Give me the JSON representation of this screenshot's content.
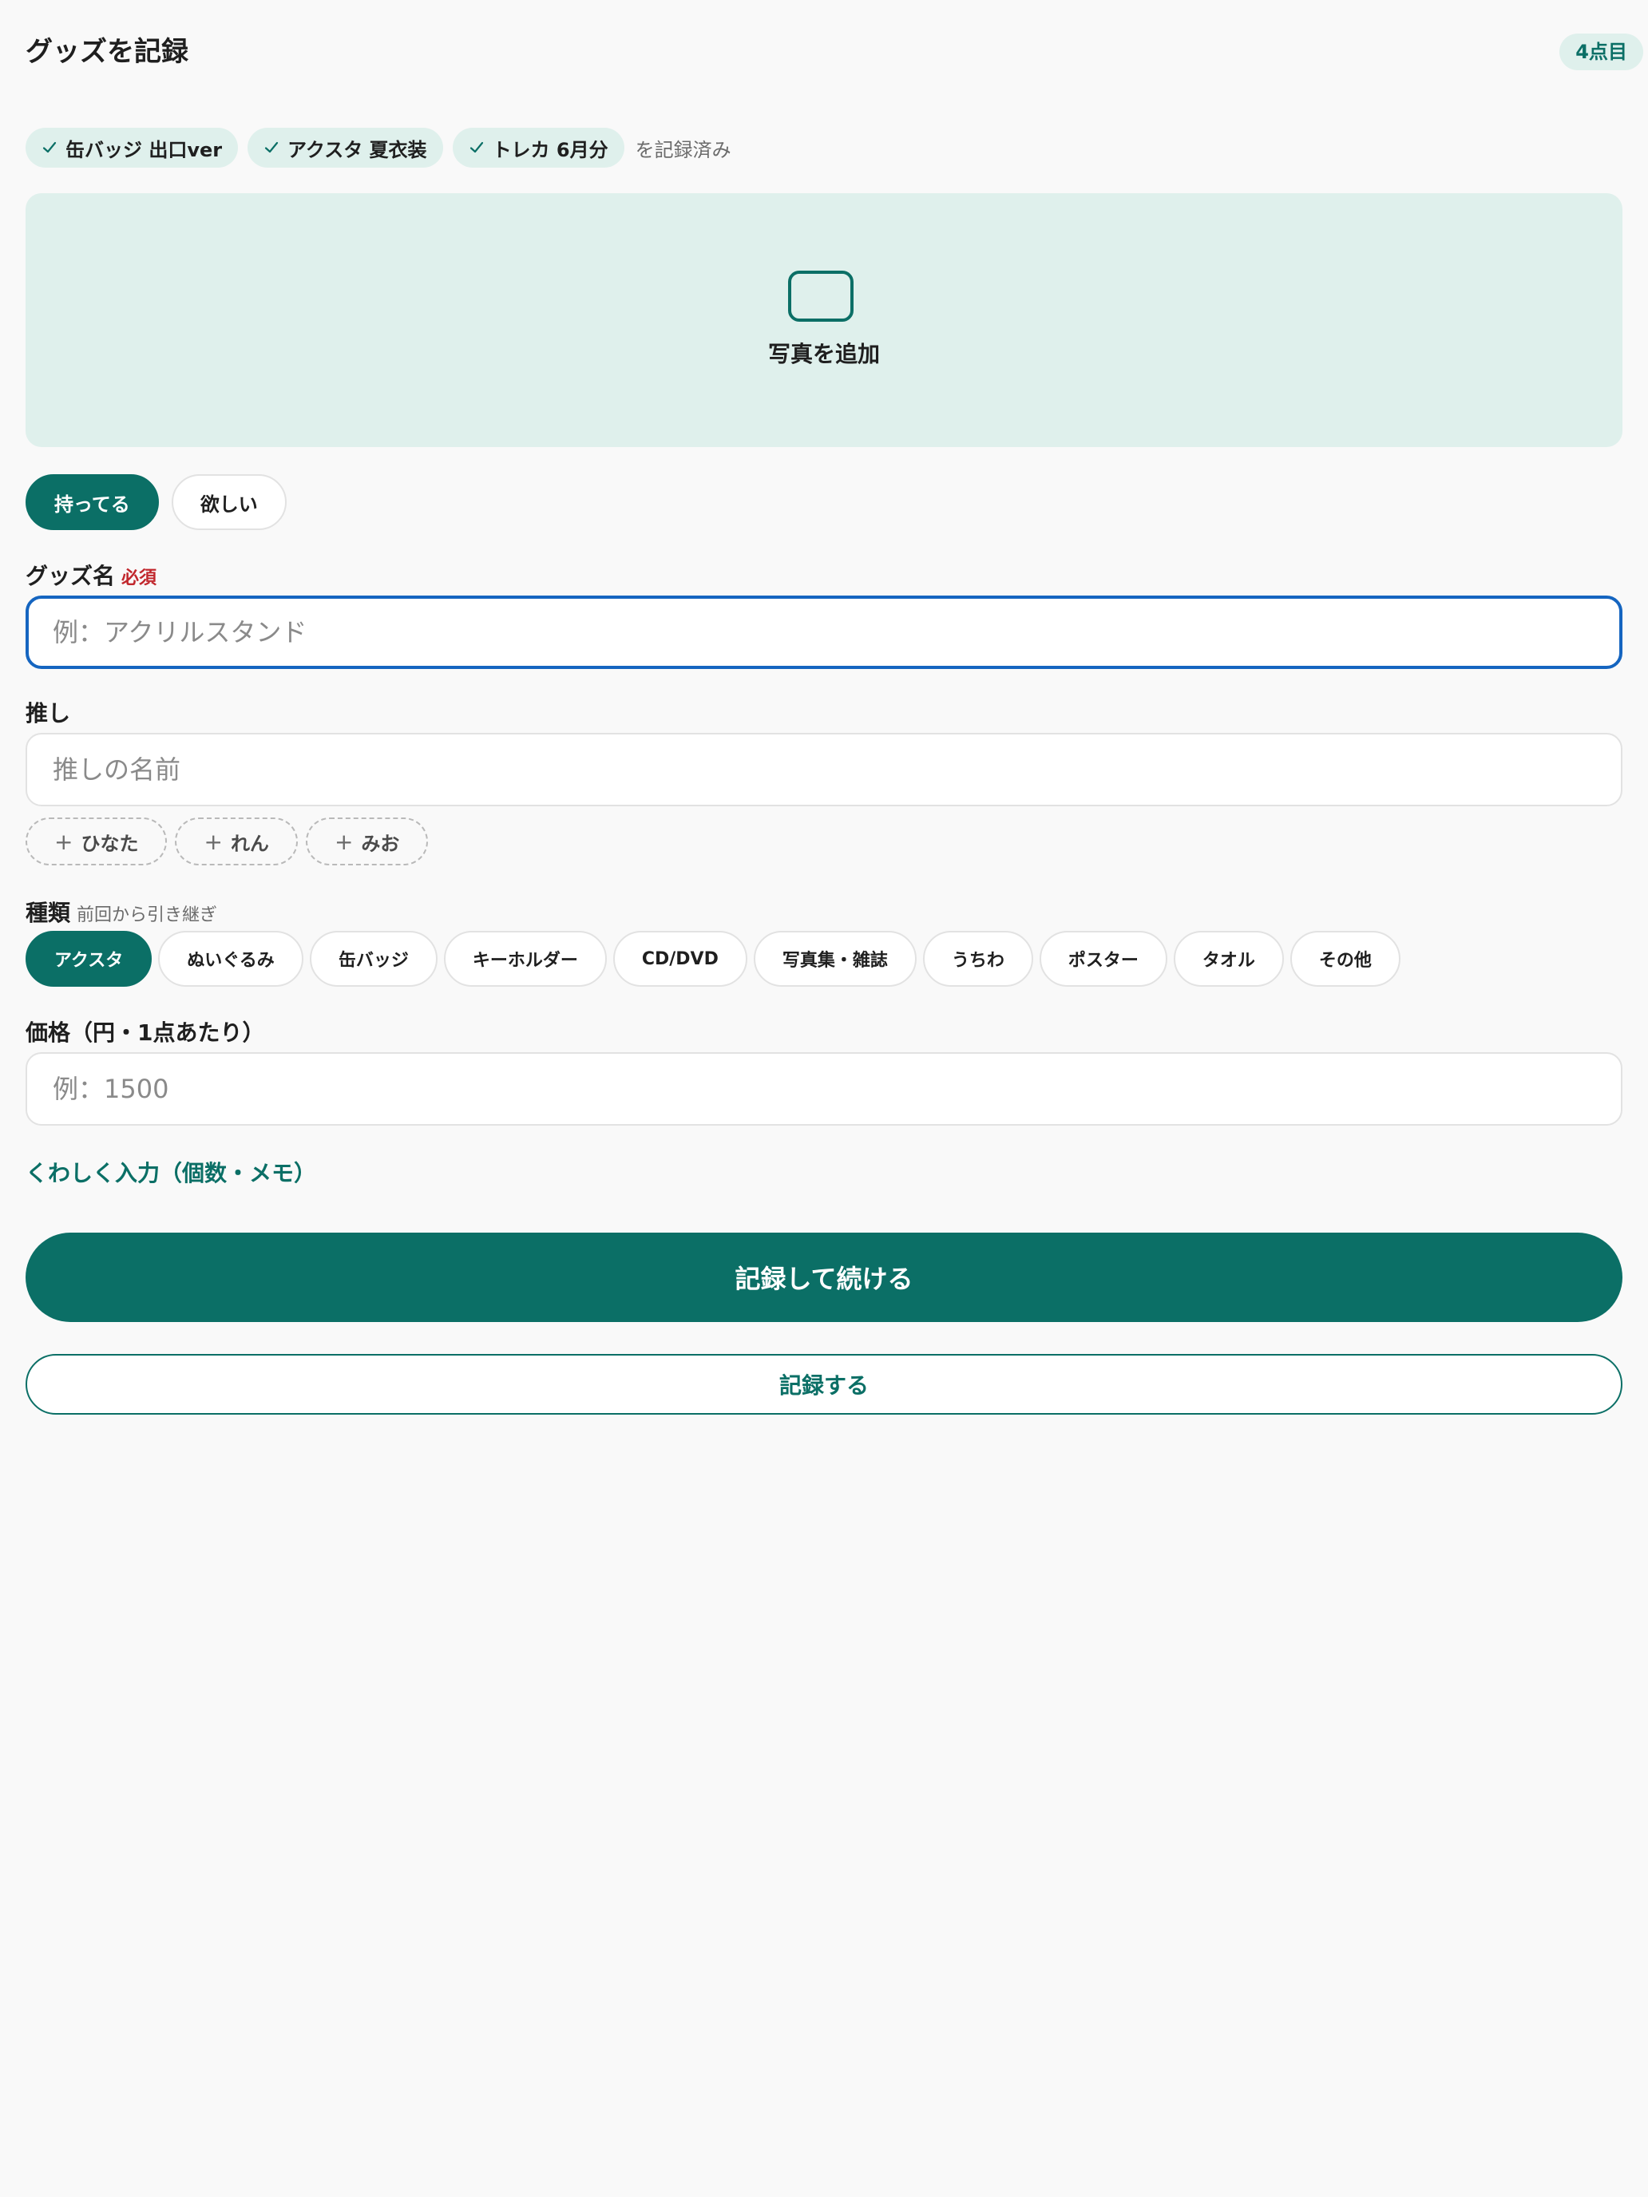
{
  "header": {
    "title": "グッズを記録",
    "count_badge": "4点目"
  },
  "recorded": {
    "items": [
      "缶バッジ 出口ver",
      "アクスタ 夏衣装",
      "トレカ 6月分"
    ],
    "suffix": "を記録済み",
    "check_icon": "check-icon"
  },
  "photo": {
    "label": "写真を追加",
    "icon": "camera-icon"
  },
  "status": {
    "options": [
      "持ってる",
      "欲しい"
    ],
    "selected": "持ってる"
  },
  "goods_name": {
    "label": "グッズ名",
    "required": "必須",
    "value": "",
    "placeholder": "例：アクリルスタンド"
  },
  "oshi": {
    "label": "推し",
    "value": "",
    "placeholder": "推しの名前",
    "suggestions": [
      "ひなた",
      "れん",
      "みお"
    ]
  },
  "category": {
    "label": "種類",
    "hint": "前回から引き継ぎ",
    "options": [
      "アクスタ",
      "ぬいぐるみ",
      "缶バッジ",
      "キーホルダー",
      "CD/DVD",
      "写真集・雑誌",
      "うちわ",
      "ポスター",
      "タオル",
      "その他"
    ],
    "selected": "アクスタ"
  },
  "price": {
    "label": "価格（円・1点あたり）",
    "value": "",
    "placeholder": "例：1500"
  },
  "details_link": "くわしく入力（個数・メモ）",
  "actions": {
    "primary": "記録して続ける",
    "secondary": "記録する"
  },
  "colors": {
    "accent": "#0b6f66",
    "accent_soft": "#dff0ec",
    "required": "#c1272d",
    "focus": "#1565c0",
    "background": "#f9f9f9"
  }
}
